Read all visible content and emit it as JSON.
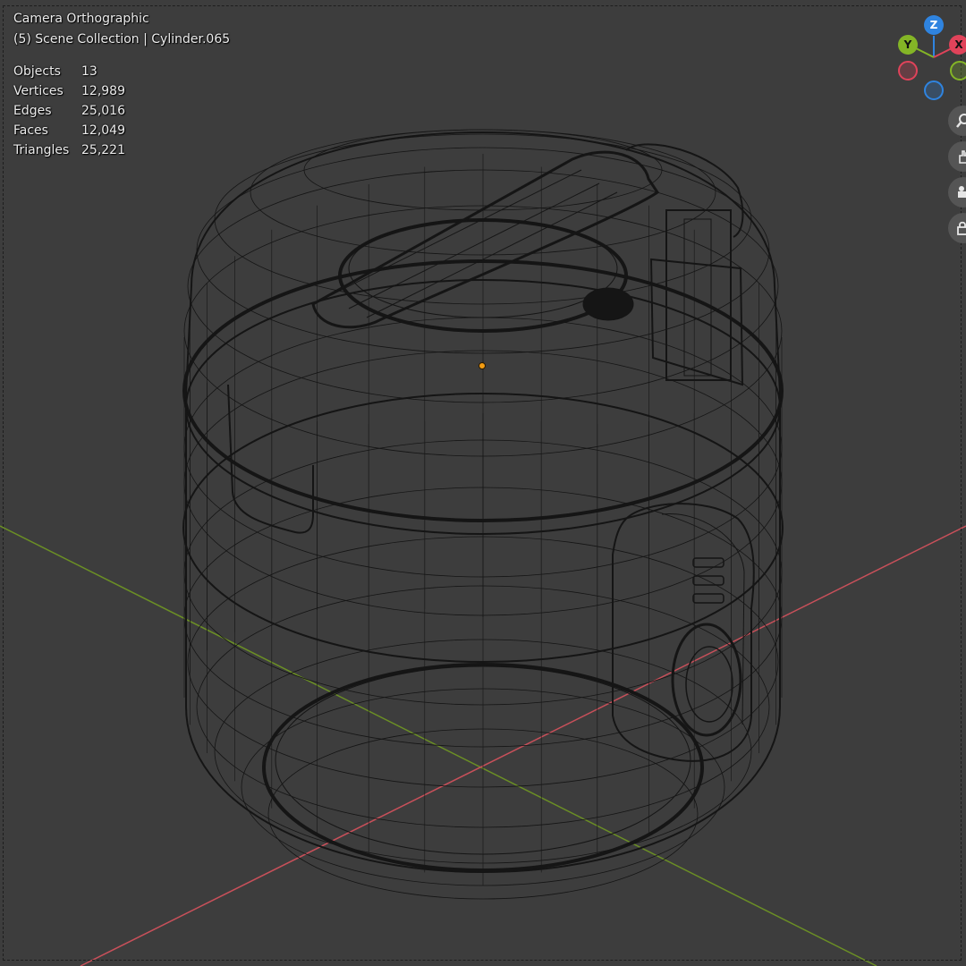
{
  "viewport": {
    "view_name": "Camera Orthographic",
    "collection_info": "(5) Scene Collection | Cylinder.065",
    "stats": [
      {
        "label": "Objects",
        "value": "13"
      },
      {
        "label": "Vertices",
        "value": "12,989"
      },
      {
        "label": "Edges",
        "value": "25,016"
      },
      {
        "label": "Faces",
        "value": "12,049"
      },
      {
        "label": "Triangles",
        "value": "25,221"
      }
    ]
  },
  "gizmo": {
    "z_label": "Z",
    "y_label": "Y",
    "x_label": "X",
    "colors": {
      "x": "#e0435a",
      "y": "#84b526",
      "z": "#2f84e0"
    }
  },
  "nav_buttons": [
    {
      "icon": "zoom-icon"
    },
    {
      "icon": "hand-pan-icon"
    },
    {
      "icon": "camera-icon"
    },
    {
      "icon": "lock-icon"
    }
  ],
  "colors": {
    "background": "#3d3d3d",
    "wire": "#151515",
    "x_axis": "#c8505a",
    "y_axis": "#6b8f25",
    "origin": "#f39c12"
  }
}
